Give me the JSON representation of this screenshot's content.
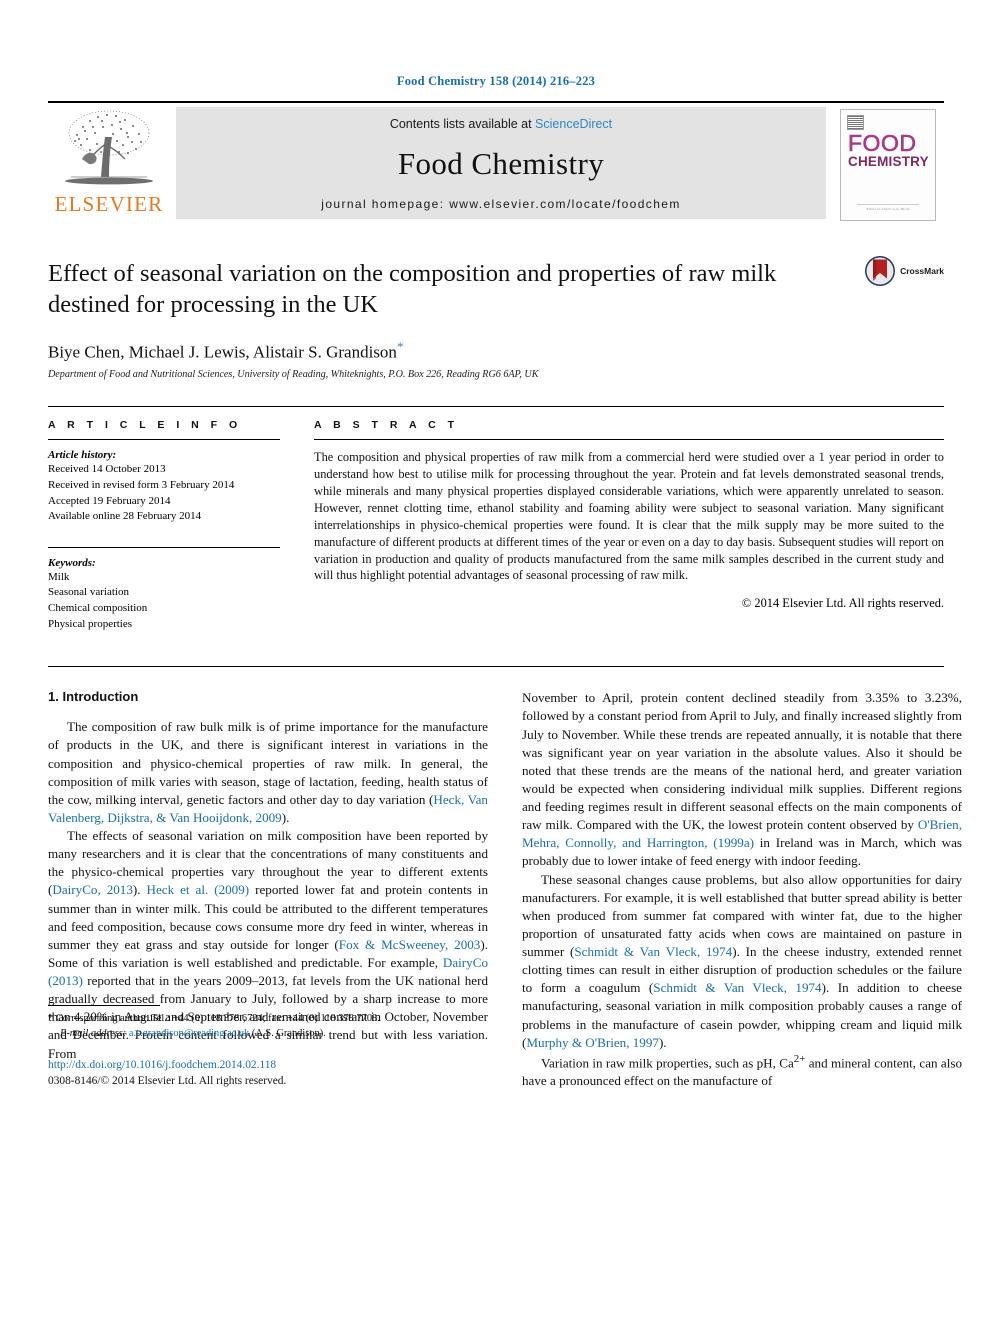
{
  "running_head": "Food Chemistry 158 (2014) 216–223",
  "masthead": {
    "publisher_name": "ELSEVIER",
    "contents_prefix": "Contents lists available at ",
    "sciencedirect": "ScienceDirect",
    "journal_title": "Food Chemistry",
    "homepage": "journal homepage: www.elsevier.com/locate/foodchem",
    "cover": {
      "line1": "FOOD",
      "line2": "CHEMISTRY",
      "footer": "Editor-in-Chief: G.G. Birch"
    }
  },
  "article": {
    "title": "Effect of seasonal variation on the composition and properties of raw milk destined for processing in the UK",
    "authors": "Biye Chen, Michael J. Lewis, Alistair S. Grandison",
    "author_star": "*",
    "affiliation": "Department of Food and Nutritional Sciences, University of Reading, Whiteknights, P.O. Box 226, Reading RG6 6AP, UK",
    "crossmark_label": "CrossMark"
  },
  "article_info": {
    "heading": "A R T I C L E  I N F O",
    "history_label": "Article history:",
    "history": [
      "Received 14 October 2013",
      "Received in revised form 3 February 2014",
      "Accepted 19 February 2014",
      "Available online 28 February 2014"
    ],
    "keywords_label": "Keywords:",
    "keywords": [
      "Milk",
      "Seasonal variation",
      "Chemical composition",
      "Physical properties"
    ]
  },
  "abstract": {
    "heading": "A B S T R A C T",
    "text": "The composition and physical properties of raw milk from a commercial herd were studied over a 1 year period in order to understand how best to utilise milk for processing throughout the year. Protein and fat levels demonstrated seasonal trends, while minerals and many physical properties displayed considerable variations, which were apparently unrelated to season. However, rennet clotting time, ethanol stability and foaming ability were subject to seasonal variation. Many significant interrelationships in physico-chemical properties were found. It is clear that the milk supply may be more suited to the manufacture of different products at different times of the year or even on a day to day basis. Subsequent studies will report on variation in production and quality of products manufactured from the same milk samples described in the current study and will thus highlight potential advantages of seasonal processing of raw milk.",
    "copyright": "© 2014 Elsevier Ltd. All rights reserved."
  },
  "body": {
    "section_number_title": "1. Introduction",
    "left_paragraphs": [
      {
        "parts": [
          {
            "t": "The composition of raw bulk milk is of prime importance for the manufacture of products in the UK, and there is significant interest in variations in the composition and physico-chemical properties of raw milk. In general, the composition of milk varies with season, stage of lactation, feeding, health status of the cow, milking interval, genetic factors and other day to day variation (",
            "ref": false
          },
          {
            "t": "Heck, Van Valenberg, Dijkstra, & Van Hooijdonk, 2009",
            "ref": true
          },
          {
            "t": ").",
            "ref": false
          }
        ]
      },
      {
        "parts": [
          {
            "t": "The effects of seasonal variation on milk composition have been reported by many researchers and it is clear that the concentrations of many constituents and the physico-chemical properties vary throughout the year to different extents (",
            "ref": false
          },
          {
            "t": "DairyCo, 2013",
            "ref": true
          },
          {
            "t": "). ",
            "ref": false
          },
          {
            "t": "Heck et al. (2009)",
            "ref": true
          },
          {
            "t": " reported lower fat and protein contents in summer than in winter milk. This could be attributed to the different temperatures and feed composition, because cows consume more dry feed in winter, whereas in summer they eat grass and stay outside for longer (",
            "ref": false
          },
          {
            "t": "Fox & McSweeney, 2003",
            "ref": true
          },
          {
            "t": "). Some of this variation is well established and predictable. For example, ",
            "ref": false
          },
          {
            "t": "DairyCo (2013)",
            "ref": true
          },
          {
            "t": " reported that in the years 2009–2013, fat levels from the UK national herd gradually decreased from January to July, followed by a sharp increase to more than 4.20% in August and September, and remained constant in October, November and December. Protein content followed a similar trend but with less variation. From",
            "ref": false
          }
        ]
      }
    ],
    "right_paragraphs": [
      {
        "indent": false,
        "parts": [
          {
            "t": "November to April, protein content declined steadily from 3.35% to 3.23%, followed by a constant period from April to July, and finally increased slightly from July to November. While these trends are repeated annually, it is notable that there was significant year on year variation in the absolute values. Also it should be noted that these trends are the means of the national herd, and greater variation would be expected when considering individual milk supplies. Different regions and feeding regimes result in different seasonal effects on the main components of raw milk. Compared with the UK, the lowest protein content observed by ",
            "ref": false
          },
          {
            "t": "O'Brien, Mehra, Connolly, and Harrington, (1999a)",
            "ref": true
          },
          {
            "t": " in Ireland was in March, which was probably due to lower intake of feed energy with indoor feeding.",
            "ref": false
          }
        ]
      },
      {
        "indent": true,
        "parts": [
          {
            "t": "These seasonal changes cause problems, but also allow opportunities for dairy manufacturers. For example, it is well established that butter spread ability is better when produced from summer fat compared with winter fat, due to the higher proportion of unsaturated fatty acids when cows are maintained on pasture in summer (",
            "ref": false
          },
          {
            "t": "Schmidt & Van Vleck, 1974",
            "ref": true
          },
          {
            "t": "). In the cheese industry, extended rennet clotting times can result in either disruption of production schedules or the failure to form a coagulum (",
            "ref": false
          },
          {
            "t": "Schmidt & Van Vleck, 1974",
            "ref": true
          },
          {
            "t": "). In addition to cheese manufacturing, seasonal variation in milk composition probably causes a range of problems in the manufacture of casein powder, whipping cream and liquid milk (",
            "ref": false
          },
          {
            "t": "Murphy & O'Brien, 1997",
            "ref": true
          },
          {
            "t": ").",
            "ref": false
          }
        ]
      },
      {
        "indent": true,
        "parts": [
          {
            "t": "Variation in raw milk properties, such as pH, Ca",
            "ref": false
          },
          {
            "t": "2+",
            "ref": false,
            "sup": true
          },
          {
            "t": " and mineral content, can also have a pronounced effect on the manufacture of",
            "ref": false
          }
        ]
      }
    ]
  },
  "footnotes": {
    "corresponding_marker": "*",
    "corresponding_text": "Corresponding author. Tel.: +44 (0) 118 378 6724; fax: +44 (0) 118 378 7708.",
    "email_label": "E-mail address:",
    "email": "a.s.grandison@reading.ac.uk",
    "email_suffix": "(A.S. Grandison).",
    "doi": "http://dx.doi.org/10.1016/j.foodchem.2014.02.118",
    "issn_line": "0308-8146/© 2014 Elsevier Ltd. All rights reserved."
  },
  "colors": {
    "link": "#1a6ea8",
    "sciencedirect": "#2e86c8",
    "elsevier_orange": "#E87722",
    "cover_magenta": "#a63a86"
  }
}
